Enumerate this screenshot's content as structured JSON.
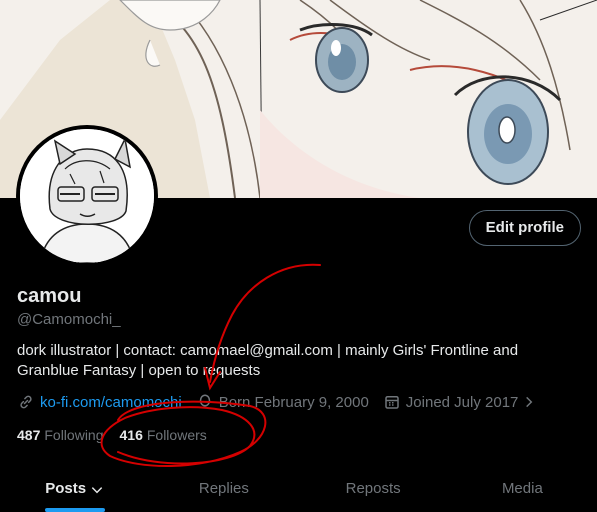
{
  "profile": {
    "edit_label": "Edit profile",
    "display_name": "camou",
    "handle": "@Camomochi_",
    "bio": "dork illustrator | contact: camomael@gmail.com | mainly Girls' Frontline and Granblue Fantasy | open to requests",
    "website": "ko-fi.com/camomochi",
    "born": "Born February 9, 2000",
    "joined": "Joined July 2017",
    "following_count": "487",
    "following_label": "Following",
    "followers_count": "416",
    "followers_label": "Followers"
  },
  "tabs": [
    {
      "label": "Posts",
      "active": true
    },
    {
      "label": "Replies",
      "active": false
    },
    {
      "label": "Reposts",
      "active": false
    },
    {
      "label": "Media",
      "active": false
    }
  ],
  "colors": {
    "accent": "#1d9bf0",
    "annotation": "#d40000"
  }
}
